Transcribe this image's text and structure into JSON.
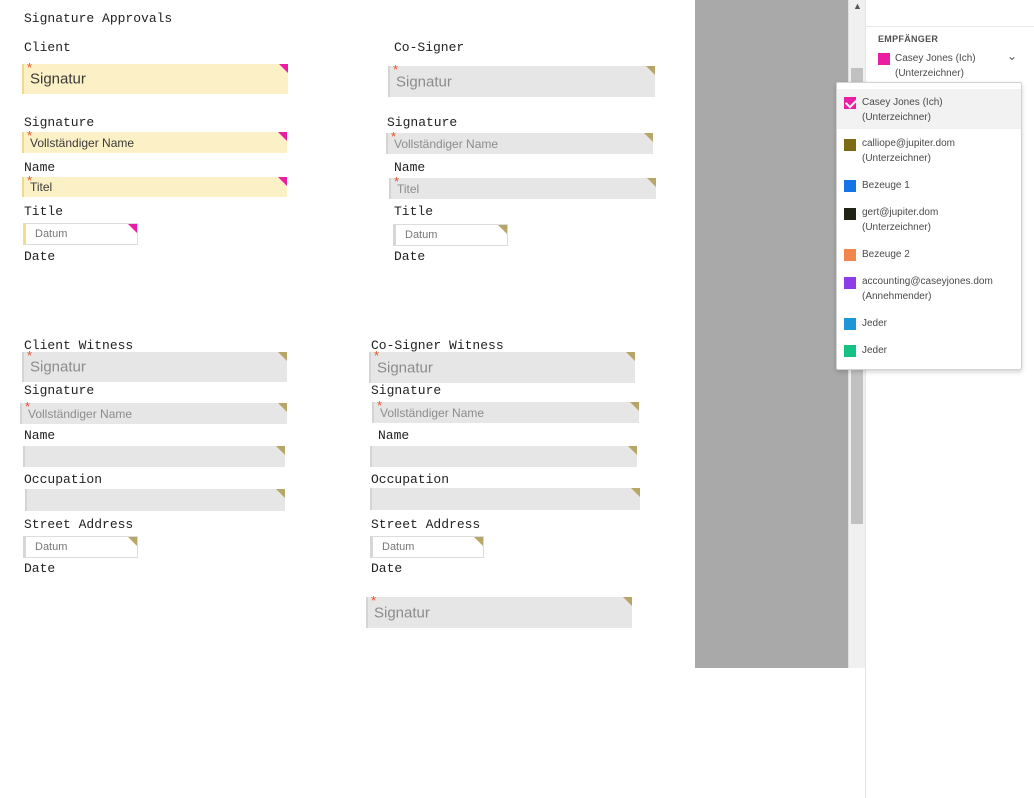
{
  "document": {
    "title": "Signature Approvals",
    "client": {
      "heading": "Client",
      "signature_label": "Signature",
      "name_label": "Name",
      "title_label": "Title",
      "date_label": "Date"
    },
    "cosigner": {
      "heading": "Co-Signer",
      "signature_label": "Signature",
      "name_label": "Name",
      "title_label": "Title",
      "date_label": "Date"
    },
    "client_witness": {
      "heading": "Client Witness",
      "signature_label": "Signature",
      "name_label": "Name",
      "occupation_label": "Occupation",
      "address_label": "Street Address",
      "date_label": "Date"
    },
    "cosigner_witness": {
      "heading": "Co-Signer Witness",
      "signature_label": "Signature",
      "name_label": "Name",
      "occupation_label": "Occupation",
      "address_label": "Street Address",
      "date_label": "Date"
    }
  },
  "fields": {
    "signature_placeholder": "Signatur",
    "fullname_placeholder": "Vollständiger Name",
    "title_placeholder": "Titel",
    "date_placeholder": "Datum",
    "required_mark": "*"
  },
  "panel": {
    "heading": "EMPFÄNGER",
    "selected": {
      "name": "Casey Jones (Ich)\n(Unterzeichner)",
      "color": "#e91ea3"
    }
  },
  "recipients": [
    {
      "name": "Casey Jones (Ich)",
      "role": "(Unterzeichner)",
      "color": "#e91ea3",
      "checked": true,
      "icon": "checkbox-icon"
    },
    {
      "name": "calliope@jupiter.dom",
      "role": "(Unterzeichner)",
      "color": "#7b6b14",
      "icon": "color-swatch-icon"
    },
    {
      "name": "Bezeuge 1",
      "color": "#1473e6",
      "icon": "color-swatch-icon"
    },
    {
      "name": "gert@jupiter.dom",
      "role": "(Unterzeichner)",
      "color": "#1f2414",
      "icon": "color-swatch-icon"
    },
    {
      "name": "Bezeuge 2",
      "color": "#f2854b",
      "icon": "color-swatch-icon"
    },
    {
      "name": "accounting@caseyjones.dom",
      "role": "(Annehmender)",
      "color": "#8d3de8",
      "icon": "color-swatch-icon"
    },
    {
      "name": "Jeder",
      "color": "#1b97d9",
      "icon": "color-swatch-icon"
    },
    {
      "name": "Jeder",
      "color": "#15c283",
      "icon": "color-swatch-icon"
    }
  ],
  "colors": {
    "mine_field": "#fcf1c6",
    "other_field": "#e6e6e6",
    "mine_marker": "#e91ea3",
    "other_marker": "#b7a667",
    "required": "#e8502c"
  },
  "icons": {
    "scroll_up": "chevron-up-icon",
    "dropdown": "chevron-down-icon",
    "corner_marker": "field-corner-marker-icon"
  }
}
